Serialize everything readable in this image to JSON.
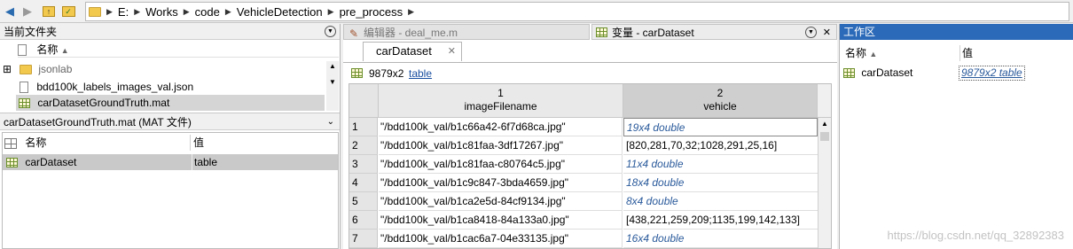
{
  "address_bar": {
    "path": [
      "E:",
      "Works",
      "code",
      "VehicleDetection",
      "pre_process"
    ]
  },
  "current_folder": {
    "title": "当前文件夹",
    "column_name": "名称",
    "items": [
      {
        "label": "jsonlab",
        "icon": "folder-icon"
      },
      {
        "label": "bdd100k_labels_images_val.json",
        "icon": "doc-icon"
      },
      {
        "label": "carDatasetGroundTruth.mat",
        "icon": "table-icon"
      }
    ]
  },
  "details": {
    "title": "carDatasetGroundTruth.mat  (MAT 文件)",
    "col_name": "名称",
    "col_value": "值",
    "row": {
      "name": "carDataset",
      "value": "table"
    }
  },
  "editor_tab": {
    "label": "编辑器 - deal_me.m"
  },
  "variables_tab": {
    "label": "变量 - carDataset"
  },
  "var_doc_tab": {
    "label": "carDataset",
    "close": "✕"
  },
  "var_toolbar": {
    "size": "9879x2",
    "type_link": "table"
  },
  "table": {
    "col1_num": "1",
    "col1_name": "imageFilename",
    "col2_num": "2",
    "col2_name": "vehicle",
    "rows": [
      {
        "n": "1",
        "file": "\"/bdd100k_val/b1c66a42-6f7d68ca.jpg\"",
        "vehicle": "19x4 double",
        "italic": true
      },
      {
        "n": "2",
        "file": "\"/bdd100k_val/b1c81faa-3df17267.jpg\"",
        "vehicle": "[820,281,70,32;1028,291,25,16]",
        "italic": false
      },
      {
        "n": "3",
        "file": "\"/bdd100k_val/b1c81faa-c80764c5.jpg\"",
        "vehicle": "11x4 double",
        "italic": true
      },
      {
        "n": "4",
        "file": "\"/bdd100k_val/b1c9c847-3bda4659.jpg\"",
        "vehicle": "18x4 double",
        "italic": true
      },
      {
        "n": "5",
        "file": "\"/bdd100k_val/b1ca2e5d-84cf9134.jpg\"",
        "vehicle": "8x4 double",
        "italic": true
      },
      {
        "n": "6",
        "file": "\"/bdd100k_val/b1ca8418-84a133a0.jpg\"",
        "vehicle": "[438,221,259,209;1135,199,142,133]",
        "italic": false
      },
      {
        "n": "7",
        "file": "\"/bdd100k_val/b1cac6a7-04e33135.jpg\"",
        "vehicle": "16x4 double",
        "italic": true
      }
    ]
  },
  "workspace": {
    "title": "工作区",
    "col_name": "名称",
    "col_value": "值",
    "row": {
      "name": "carDataset",
      "value": "9879x2 table"
    }
  },
  "watermark": "https://blog.csdn.net/qq_32892383",
  "colors": {
    "workspace_header": "#2b6ab8",
    "link": "#1a4fa0",
    "italic_value": "#2a5a9b"
  }
}
